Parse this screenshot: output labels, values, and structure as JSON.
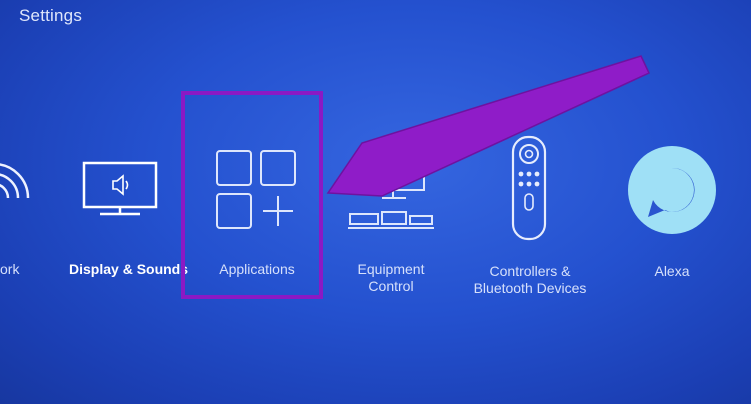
{
  "header": {
    "title": "Settings"
  },
  "menu": {
    "items": [
      {
        "label": "ork",
        "icon": "wifi-icon"
      },
      {
        "label": "Display & Sounds",
        "icon": "tv-speaker-icon"
      },
      {
        "label": "Applications",
        "icon": "applications-grid-icon"
      },
      {
        "label_line1": "Equipment",
        "label_line2": "Control",
        "icon": "equipment-icon"
      },
      {
        "label_line1": "Controllers &",
        "label_line2": "Bluetooth Devices",
        "icon": "remote-icon"
      },
      {
        "label": "Alexa",
        "icon": "alexa-icon"
      }
    ]
  },
  "annotation": {
    "highlight_color": "#8b19c4",
    "arrow_color": "#8f1cc8"
  }
}
